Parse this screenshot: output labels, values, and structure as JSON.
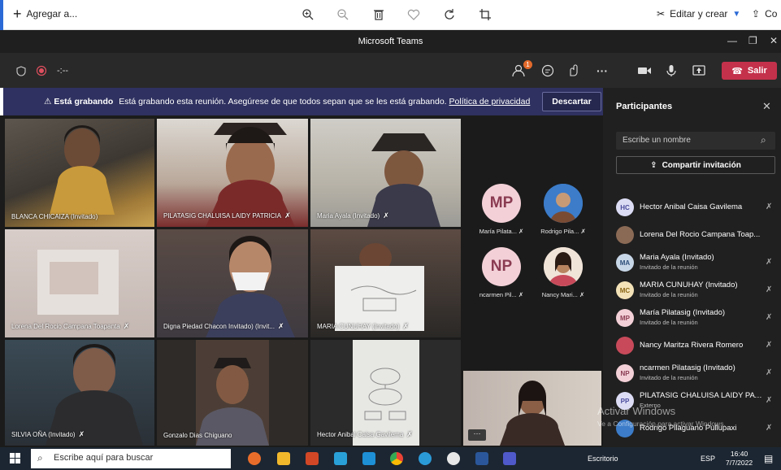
{
  "viewer": {
    "add_label": "Agregar a...",
    "edit_label": "Editar y crear",
    "share_label": "Co",
    "tools": [
      "zoom-in-icon",
      "zoom-out-icon",
      "delete-icon",
      "favorite-icon",
      "rotate-icon",
      "crop-icon"
    ]
  },
  "window": {
    "title": "Microsoft Teams"
  },
  "meeting": {
    "timer": "-:--",
    "participants_badge": "1",
    "leave_label": "Salir"
  },
  "banner": {
    "bold": "Está grabando",
    "text": "Está grabando esta reunión. Asegúrese de que todos sepan que se les está grabando.",
    "link": "Política de privacidad",
    "dismiss": "Descartar"
  },
  "video_tiles": [
    {
      "name": "BLANCA CHICAIZA (Invitado)"
    },
    {
      "name": "PILATASIG CHALUISA LAIDY PATRICIA"
    },
    {
      "name": "Maria Ayala (Invitado)"
    },
    {
      "name": "Lorena Del Rocio Campana Toapanta"
    },
    {
      "name": "Digna Piedad Chacon Invitado) (Invit..."
    },
    {
      "name": "MARIA CUNUHAY (Invitado)"
    },
    {
      "name": "SILVIA OÑA (Invitado)"
    },
    {
      "name": "Gonzalo Dias Chiguano"
    },
    {
      "name": "Hector Anibal Caisa Gavilema"
    }
  ],
  "avatar_tiles": [
    {
      "initials": "MP",
      "label": "María Pilata..."
    },
    {
      "initials": "",
      "label": "Rodrigo Pila..."
    },
    {
      "initials": "NP",
      "label": "ncarmen Pil..."
    },
    {
      "initials": "",
      "label": "Nancy Mari..."
    }
  ],
  "more_label": "···",
  "panel": {
    "title": "Participantes",
    "search_placeholder": "Escribe un nombre",
    "share_label": "Compartir invitación",
    "participants": [
      {
        "initials": "HC",
        "name": "Hector Anibal Caisa Gavilema",
        "sub": ""
      },
      {
        "initials": "",
        "name": "Lorena Del Rocio Campana Toap...",
        "sub": ""
      },
      {
        "initials": "MA",
        "name": "Maria Ayala (Invitado)",
        "sub": "Invitado de la reunión"
      },
      {
        "initials": "MC",
        "name": "MARIA CUNUHAY (Invitado)",
        "sub": "Invitado de la reunión"
      },
      {
        "initials": "MP",
        "name": "María Pilatasig (Invitado)",
        "sub": "Invitado de la reunión"
      },
      {
        "initials": "",
        "name": "Nancy Maritza Rivera Romero",
        "sub": ""
      },
      {
        "initials": "NP",
        "name": "ncarmen Pilatasig (Invitado)",
        "sub": "Invitado de la reunión"
      },
      {
        "initials": "PP",
        "name": "PILATASIG CHALUISA LAIDY PAT...",
        "sub": "Externo"
      },
      {
        "initials": "",
        "name": "Rodrigo Pilaguano Pullupaxi",
        "sub": ""
      }
    ]
  },
  "watermark": {
    "title": "Activar Windows",
    "sub": "Ve a Configuración para activar Windows."
  },
  "taskbar": {
    "search_placeholder": "Escribe aquí para buscar",
    "desktop_label": "Escritorio",
    "lang": "ESP",
    "time": "16:40",
    "date": "7/7/2022"
  },
  "colors": {
    "banner_bg": "#2f3160",
    "leave_red": "#c4314b",
    "panel_bg": "#202020",
    "accent": "#2b6ad6"
  }
}
